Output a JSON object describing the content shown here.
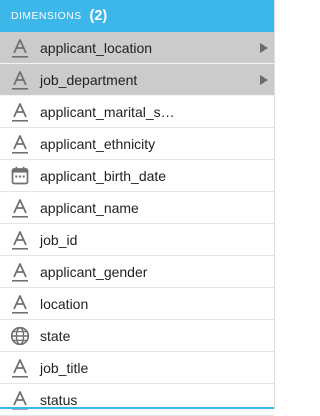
{
  "header": {
    "title": "DIMENSIONS",
    "count": "(2)"
  },
  "items": [
    {
      "label": "applicant_location",
      "icon": "text-type-icon",
      "selected": true,
      "expandable": true
    },
    {
      "label": "job_department",
      "icon": "text-type-icon",
      "selected": true,
      "expandable": true
    },
    {
      "label": "applicant_marital_s…",
      "icon": "text-type-icon",
      "selected": false,
      "expandable": false
    },
    {
      "label": "applicant_ethnicity",
      "icon": "text-type-icon",
      "selected": false,
      "expandable": false
    },
    {
      "label": "applicant_birth_date",
      "icon": "calendar-icon",
      "selected": false,
      "expandable": false
    },
    {
      "label": "applicant_name",
      "icon": "text-type-icon",
      "selected": false,
      "expandable": false
    },
    {
      "label": "job_id",
      "icon": "text-type-icon",
      "selected": false,
      "expandable": false
    },
    {
      "label": "applicant_gender",
      "icon": "text-type-icon",
      "selected": false,
      "expandable": false
    },
    {
      "label": "location",
      "icon": "text-type-icon",
      "selected": false,
      "expandable": false
    },
    {
      "label": "state",
      "icon": "globe-icon",
      "selected": false,
      "expandable": false
    },
    {
      "label": "job_title",
      "icon": "text-type-icon",
      "selected": false,
      "expandable": false
    },
    {
      "label": "status",
      "icon": "text-type-icon",
      "selected": false,
      "expandable": false
    }
  ]
}
